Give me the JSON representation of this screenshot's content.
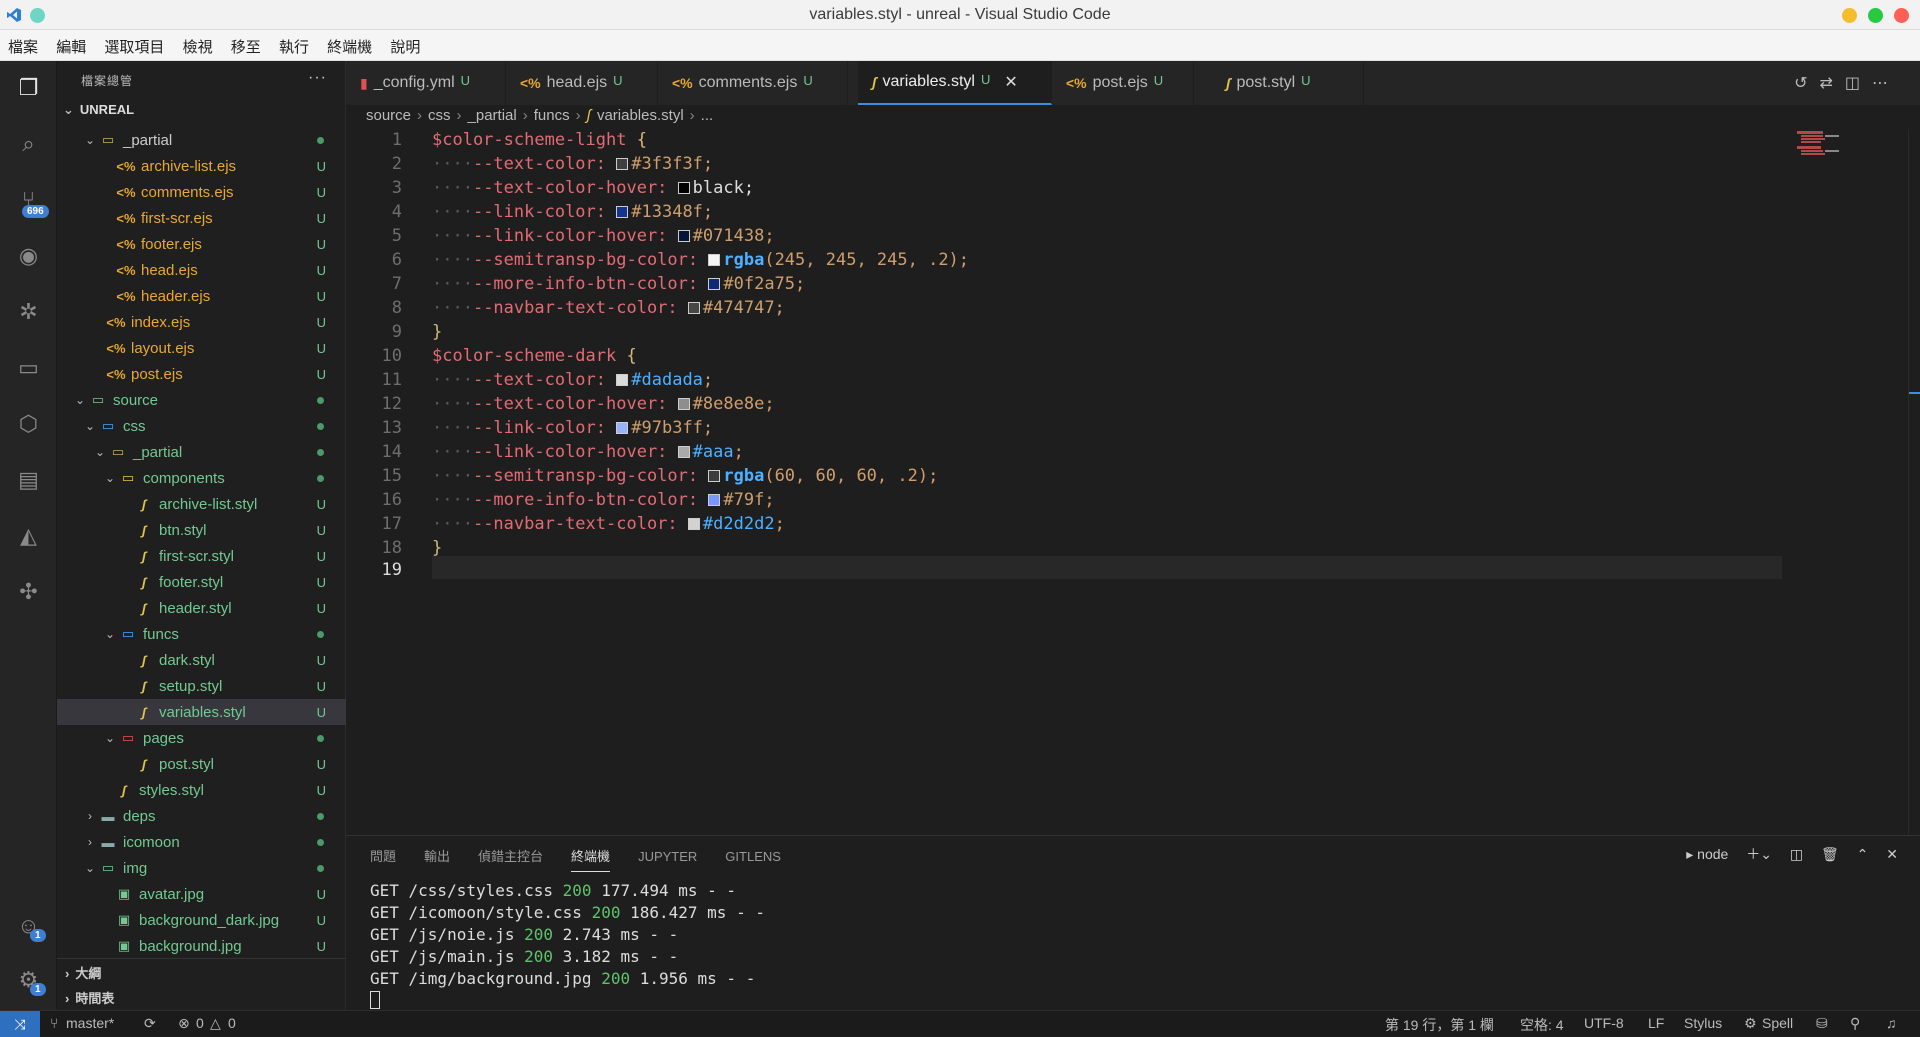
{
  "window": {
    "title": "variables.styl - unreal - Visual Studio Code"
  },
  "menu": [
    "檔案",
    "編輯",
    "選取項目",
    "檢視",
    "移至",
    "執行",
    "終端機",
    "說明"
  ],
  "activity": {
    "scm_badge": "696",
    "accounts_badge": "1",
    "settings_badge": "1"
  },
  "sidebar": {
    "header": "檔案總管",
    "root": "UNREAL",
    "outline": "大綱",
    "timeline": "時間表",
    "items": [
      {
        "label": "_partial",
        "status": ""
      },
      {
        "label": "archive-list.ejs",
        "status": "U"
      },
      {
        "label": "comments.ejs",
        "status": "U"
      },
      {
        "label": "first-scr.ejs",
        "status": "U"
      },
      {
        "label": "footer.ejs",
        "status": "U"
      },
      {
        "label": "head.ejs",
        "status": "U"
      },
      {
        "label": "header.ejs",
        "status": "U"
      },
      {
        "label": "index.ejs",
        "status": "U"
      },
      {
        "label": "layout.ejs",
        "status": "U"
      },
      {
        "label": "post.ejs",
        "status": "U"
      },
      {
        "label": "source",
        "status": ""
      },
      {
        "label": "css",
        "status": ""
      },
      {
        "label": "_partial",
        "status": ""
      },
      {
        "label": "components",
        "status": ""
      },
      {
        "label": "archive-list.styl",
        "status": "U"
      },
      {
        "label": "btn.styl",
        "status": "U"
      },
      {
        "label": "first-scr.styl",
        "status": "U"
      },
      {
        "label": "footer.styl",
        "status": "U"
      },
      {
        "label": "header.styl",
        "status": "U"
      },
      {
        "label": "funcs",
        "status": ""
      },
      {
        "label": "dark.styl",
        "status": "U"
      },
      {
        "label": "setup.styl",
        "status": "U"
      },
      {
        "label": "variables.styl",
        "status": "U"
      },
      {
        "label": "pages",
        "status": ""
      },
      {
        "label": "post.styl",
        "status": "U"
      },
      {
        "label": "styles.styl",
        "status": "U"
      },
      {
        "label": "deps",
        "status": ""
      },
      {
        "label": "icomoon",
        "status": ""
      },
      {
        "label": "img",
        "status": ""
      },
      {
        "label": "avatar.jpg",
        "status": "U"
      },
      {
        "label": "background_dark.jpg",
        "status": "U"
      },
      {
        "label": "background.jpg",
        "status": "U"
      }
    ]
  },
  "tabs": [
    {
      "label": "_config.yml",
      "status": "U"
    },
    {
      "label": "head.ejs",
      "status": "U"
    },
    {
      "label": "comments.ejs",
      "status": "U"
    },
    {
      "label": "variables.styl",
      "status": "U"
    },
    {
      "label": "post.ejs",
      "status": "U"
    },
    {
      "label": "post.styl",
      "status": "U"
    }
  ],
  "breadcrumb": [
    "source",
    "css",
    "_partial",
    "funcs",
    "variables.styl",
    "..."
  ],
  "code": {
    "ln": [
      "1",
      "2",
      "3",
      "4",
      "5",
      "6",
      "7",
      "8",
      "9",
      "10",
      "11",
      "12",
      "13",
      "14",
      "15",
      "16",
      "17",
      "18",
      "19"
    ],
    "light_sel": "$color-scheme-light",
    "dark_sel": "$color-scheme-dark",
    "open": "{",
    "close": "}",
    "props": [
      "--text-color:",
      "--text-color-hover:",
      "--link-color:",
      "--link-color-hover:",
      "--semitransp-bg-color:",
      "--more-info-btn-color:",
      "--navbar-text-color:"
    ],
    "light_vals": [
      "#3f3f3f;",
      "black;",
      "#13348f;",
      "#071438;",
      "rgba",
      "(245, 245, 245, .2);",
      "#0f2a75;",
      "#474747;"
    ],
    "dark_vals": [
      "#dadada",
      "#8e8e8e;",
      "#97b3ff;",
      "#aaa",
      "rgba",
      "(60, 60, 60, .2);",
      "#79f;",
      "#d2d2d2"
    ],
    "semi": ";",
    "light_colors": [
      "#3f3f3f",
      "#000000",
      "#13348f",
      "#071438",
      "#f5f5f5",
      "#0f2a75",
      "#474747"
    ],
    "dark_colors": [
      "#dadada",
      "#8e8e8e",
      "#97b3ff",
      "#aaaaaa",
      "#3c3c3c",
      "#7799ff",
      "#d2d2d2"
    ]
  },
  "panel": {
    "tabs": [
      "問題",
      "輸出",
      "偵錯主控台",
      "終端機",
      "JUPYTER",
      "GITLENS"
    ],
    "shell": "node",
    "lines": [
      {
        "pre": "GET /css/styles.css ",
        "code": "200",
        "post": " 177.494 ms - -"
      },
      {
        "pre": "GET /icomoon/style.css ",
        "code": "200",
        "post": " 186.427 ms - -"
      },
      {
        "pre": "GET /js/noie.js ",
        "code": "200",
        "post": " 2.743 ms - -"
      },
      {
        "pre": "GET /js/main.js ",
        "code": "200",
        "post": " 3.182 ms - -"
      },
      {
        "pre": "GET /img/background.jpg ",
        "code": "200",
        "post": " 1.956 ms - -"
      }
    ]
  },
  "status": {
    "branch": "master*",
    "errors": "0",
    "warnings": "0",
    "position": "第 19 行，第 1 欄",
    "spaces": "空格: 4",
    "encoding": "UTF-8",
    "eol": "LF",
    "language": "Stylus",
    "spell": "Spell"
  },
  "colors": {
    "accent": "#3c8fe0",
    "untracked": "#73c991"
  }
}
